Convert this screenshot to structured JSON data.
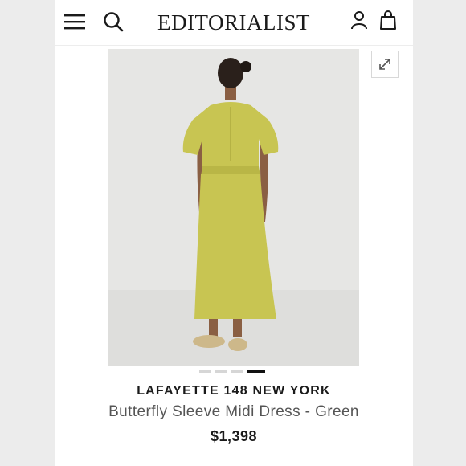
{
  "header": {
    "logo_text": "EDITORIALIST",
    "menu_icon": "hamburger-menu-icon",
    "search_icon": "search-icon",
    "account_icon": "account-icon",
    "bag_icon": "shopping-bag-icon"
  },
  "gallery": {
    "expand_icon": "expand-icon",
    "image_count": 4,
    "active_index": 4
  },
  "product": {
    "brand": "LAFAYETTE 148 NEW YORK",
    "name": "Butterfly Sleeve Midi Dress - Green",
    "price": "$1,398"
  },
  "colors": {
    "dress": "#c8c552",
    "background": "#e6e6e4",
    "text": "#1a1a1a"
  }
}
